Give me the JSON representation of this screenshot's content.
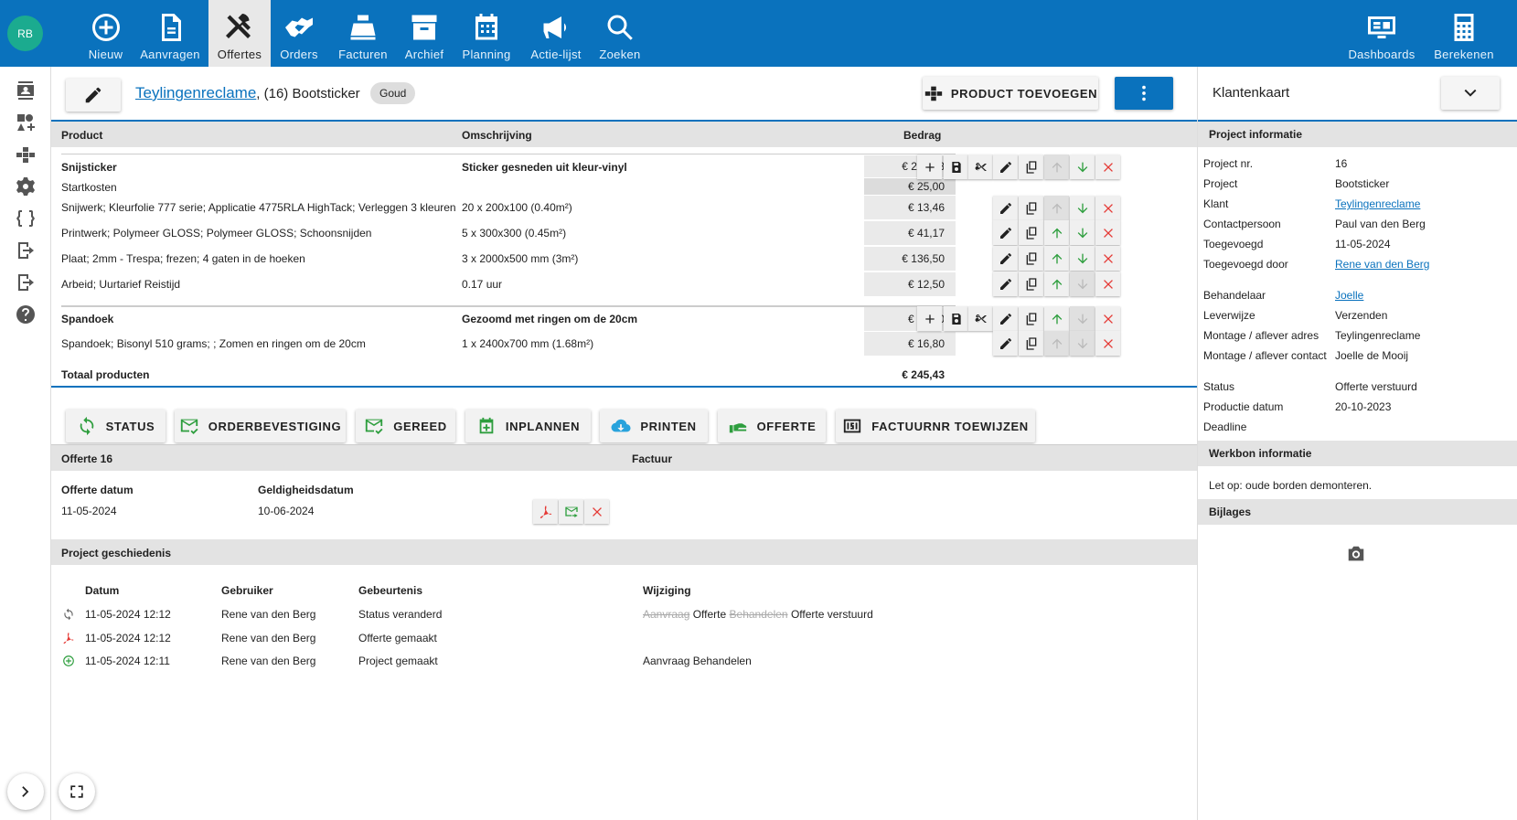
{
  "user": {
    "initials": "RB"
  },
  "nav": [
    {
      "label": "Nieuw",
      "icon": "plus-circle-icon"
    },
    {
      "label": "Aanvragen",
      "icon": "document-icon"
    },
    {
      "label": "Offertes",
      "icon": "tools-icon"
    },
    {
      "label": "Orders",
      "icon": "handshake-icon"
    },
    {
      "label": "Facturen",
      "icon": "cash-register-icon"
    },
    {
      "label": "Archief",
      "icon": "archive-icon"
    },
    {
      "label": "Planning",
      "icon": "calendar-icon"
    },
    {
      "label": "Actie-lijst",
      "icon": "megaphone-icon"
    },
    {
      "label": "Zoeken",
      "icon": "search-icon"
    }
  ],
  "nav_right": [
    {
      "label": "Dashboards",
      "icon": "dashboard-icon"
    },
    {
      "label": "Berekenen",
      "icon": "calculator-icon"
    }
  ],
  "header": {
    "customer": "Teylingenreclame",
    "project": ", (16) Bootsticker",
    "badge": "Goud",
    "add_product": "PRODUCT TOEVOEGEN"
  },
  "table": {
    "col_product": "Product",
    "col_desc": "Omschrijving",
    "col_amount": "Bedrag",
    "groups": [
      {
        "name": "Snijsticker",
        "desc": "Sticker gesneden uit kleur-vinyl",
        "amount": "€ 228,63",
        "lines": [
          {
            "name": "Startkosten",
            "desc": "",
            "amount": "€ 25,00"
          },
          {
            "name": "Snijwerk; Kleurfolie 777 serie; Applicatie 4775RLA HighTack; Verleggen 3 kleuren",
            "desc": "20 x 200x100 (0.40m²)",
            "amount": "€ 13,46"
          },
          {
            "name": "Printwerk; Polymeer GLOSS; Polymeer GLOSS; Schoonsnijden",
            "desc": "5 x 300x300 (0.45m²)",
            "amount": "€ 41,17"
          },
          {
            "name": "Plaat; 2mm - Trespa; frezen; 4 gaten in de hoeken",
            "desc": "3 x 2000x500 mm (3m²)",
            "amount": "€ 136,50"
          },
          {
            "name": "Arbeid; Uurtarief Reistijd",
            "desc": "0.17 uur",
            "amount": "€ 12,50"
          }
        ]
      },
      {
        "name": "Spandoek",
        "desc": "Gezoomd met ringen om de 20cm",
        "amount": "€ 16,80",
        "lines": [
          {
            "name": "Spandoek; Bisonyl 510 grams; ; Zomen en ringen om de 20cm",
            "desc": "1 x 2400x700 mm (1.68m²)",
            "amount": "€ 16,80"
          }
        ]
      }
    ],
    "total_label": "Totaal producten",
    "total": "€ 245,43"
  },
  "actions": [
    "STATUS",
    "ORDERBEVESTIGING",
    "GEREED",
    "INPLANNEN",
    "PRINTEN",
    "OFFERTE",
    "FACTUURNR TOEWIJZEN"
  ],
  "quote": {
    "title": "Offerte 16",
    "invoice_title": "Factuur",
    "date_label": "Offerte datum",
    "date": "11-05-2024",
    "valid_label": "Geldigheidsdatum",
    "valid": "10-06-2024"
  },
  "history": {
    "title": "Project geschiedenis",
    "cols": [
      "Datum",
      "Gebruiker",
      "Gebeurtenis",
      "Wijziging"
    ],
    "rows": [
      {
        "icon": "sync-icon",
        "date": "11-05-2024 12:12",
        "user": "Rene van den Berg",
        "event": "Status veranderd",
        "old1": "Aanvraag",
        "new1": "Offerte",
        "old2": "Behandelen",
        "new2": "Offerte verstuurd"
      },
      {
        "icon": "pdf-icon",
        "date": "11-05-2024 12:12",
        "user": "Rene van den Berg",
        "event": "Offerte gemaakt",
        "change": ""
      },
      {
        "icon": "plus-circle-icon",
        "date": "11-05-2024 12:11",
        "user": "Rene van den Berg",
        "event": "Project gemaakt",
        "change": "Aanvraag Behandelen"
      }
    ]
  },
  "panel": {
    "title": "Klantenkaart",
    "project_info": "Project informatie",
    "fields1": [
      {
        "k": "Project nr.",
        "v": "16"
      },
      {
        "k": "Project",
        "v": "Bootsticker"
      },
      {
        "k": "Klant",
        "v": "Teylingenreclame",
        "link": true
      },
      {
        "k": "Contactpersoon",
        "v": "Paul van den Berg"
      },
      {
        "k": "Toegevoegd",
        "v": "11-05-2024"
      },
      {
        "k": "Toegevoegd door",
        "v": "Rene van den Berg",
        "link": true
      }
    ],
    "fields2": [
      {
        "k": "Behandelaar",
        "v": "Joelle",
        "link": true
      },
      {
        "k": "Leverwijze",
        "v": "Verzenden"
      },
      {
        "k": "Montage / aflever adres",
        "v": "Teylingenreclame"
      },
      {
        "k": "Montage / aflever contact",
        "v": "Joelle de Mooij"
      }
    ],
    "fields3": [
      {
        "k": "Status",
        "v": "Offerte verstuurd"
      },
      {
        "k": "Productie datum",
        "v": "20-10-2023"
      },
      {
        "k": "Deadline",
        "v": ""
      }
    ],
    "workorder_title": "Werkbon informatie",
    "workorder_text": "Let op: oude borden demonteren.",
    "attachments_title": "Bijlages"
  },
  "colors": {
    "brand": "#0a72bd",
    "green": "#2e9e3e",
    "red": "#e53935"
  }
}
